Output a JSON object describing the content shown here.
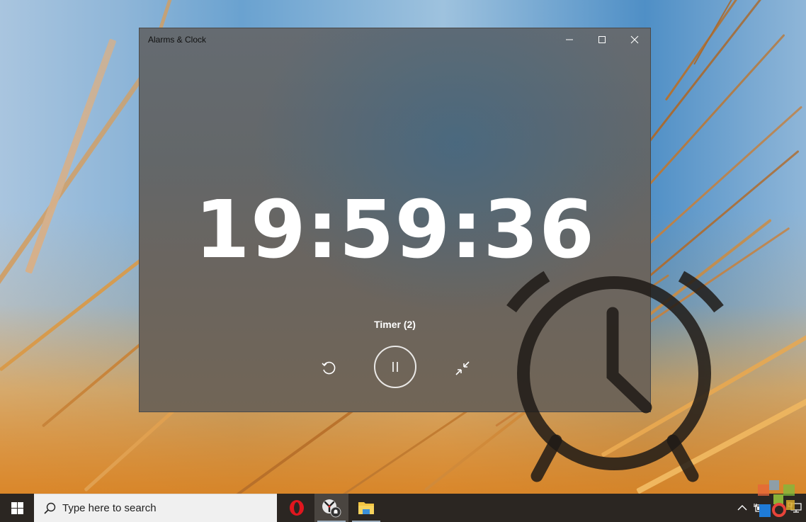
{
  "window": {
    "title": "Alarms & Clock",
    "controls": {
      "minimize": "minimize-icon",
      "maximize": "maximize-icon",
      "close": "close-icon"
    }
  },
  "timer": {
    "time": "19:59:36",
    "label": "Timer (2)",
    "state": "running",
    "controls": {
      "reset": "reset-icon",
      "pause": "pause-icon",
      "compact_overlay": "compact-overlay-icon"
    }
  },
  "taskbar": {
    "start": "windows-logo-icon",
    "search_placeholder": "Type here to search",
    "pinned_apps": [
      {
        "name": "Opera",
        "icon": "opera-icon",
        "active": false
      },
      {
        "name": "Alarms & Clock",
        "icon": "alarms-clock-icon",
        "active": true
      },
      {
        "name": "File Explorer",
        "icon": "file-explorer-icon",
        "active": false
      }
    ],
    "tray": {
      "show_hidden": "chevron-up-icon",
      "battery": "battery-charging-icon",
      "network": "network-icon"
    }
  },
  "overlay": {
    "decorative_icon": "alarm-clock-icon"
  },
  "colors": {
    "window_bg": "#656a6e",
    "timer_text": "#ffffff",
    "taskbar_bg": "#2b2622",
    "search_bg": "#f0f0f0",
    "opera_red": "#e0161e",
    "folder_yellow": "#f4c542"
  }
}
